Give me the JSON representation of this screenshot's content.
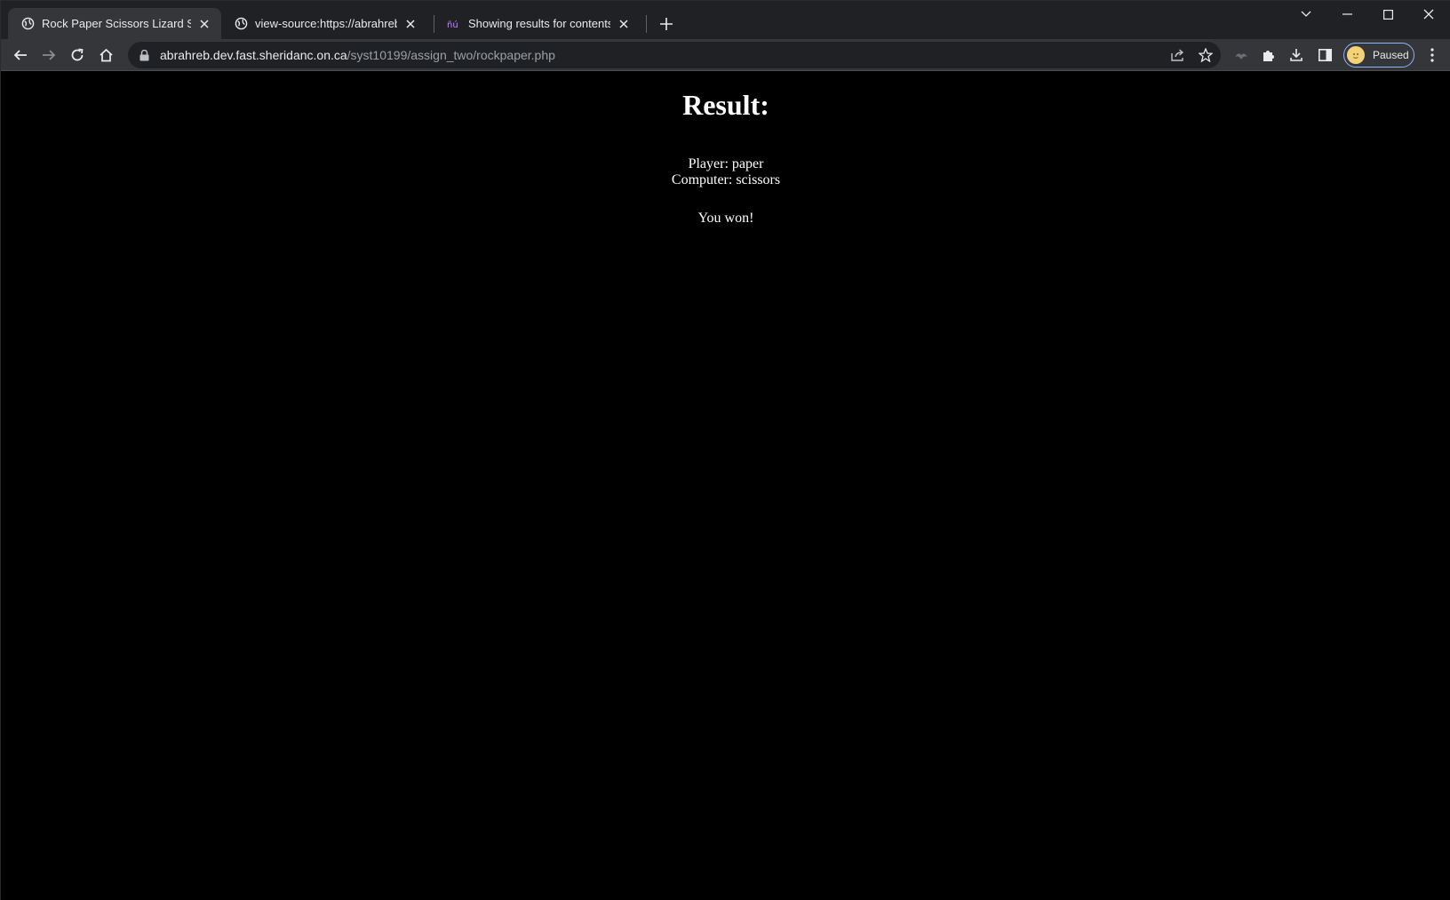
{
  "browser": {
    "tabs": [
      {
        "title": "Rock Paper Scissors Lizard Spock",
        "favicon": "globe-icon",
        "active": true
      },
      {
        "title": "view-source:https://abrahreb.dev",
        "favicon": "globe-icon",
        "active": false
      },
      {
        "title": "Showing results for contents of t",
        "favicon": "search-engine-icon",
        "active": false
      }
    ],
    "address_bar": {
      "host": "abrahreb.dev.fast.sheridanc.on.ca",
      "path": "/syst10199/assign_two/rockpaper.php"
    },
    "profile": {
      "status": "Paused"
    }
  },
  "page": {
    "heading": "Result:",
    "player_line": "Player: paper",
    "computer_line": "Computer: scissors",
    "outcome": "You won!"
  },
  "colors": {
    "page_background": "#000000",
    "page_text": "#ffffff",
    "tabstrip": "#202124",
    "toolbar": "#35363a",
    "profile_chip_border": "#8ab4f8"
  }
}
